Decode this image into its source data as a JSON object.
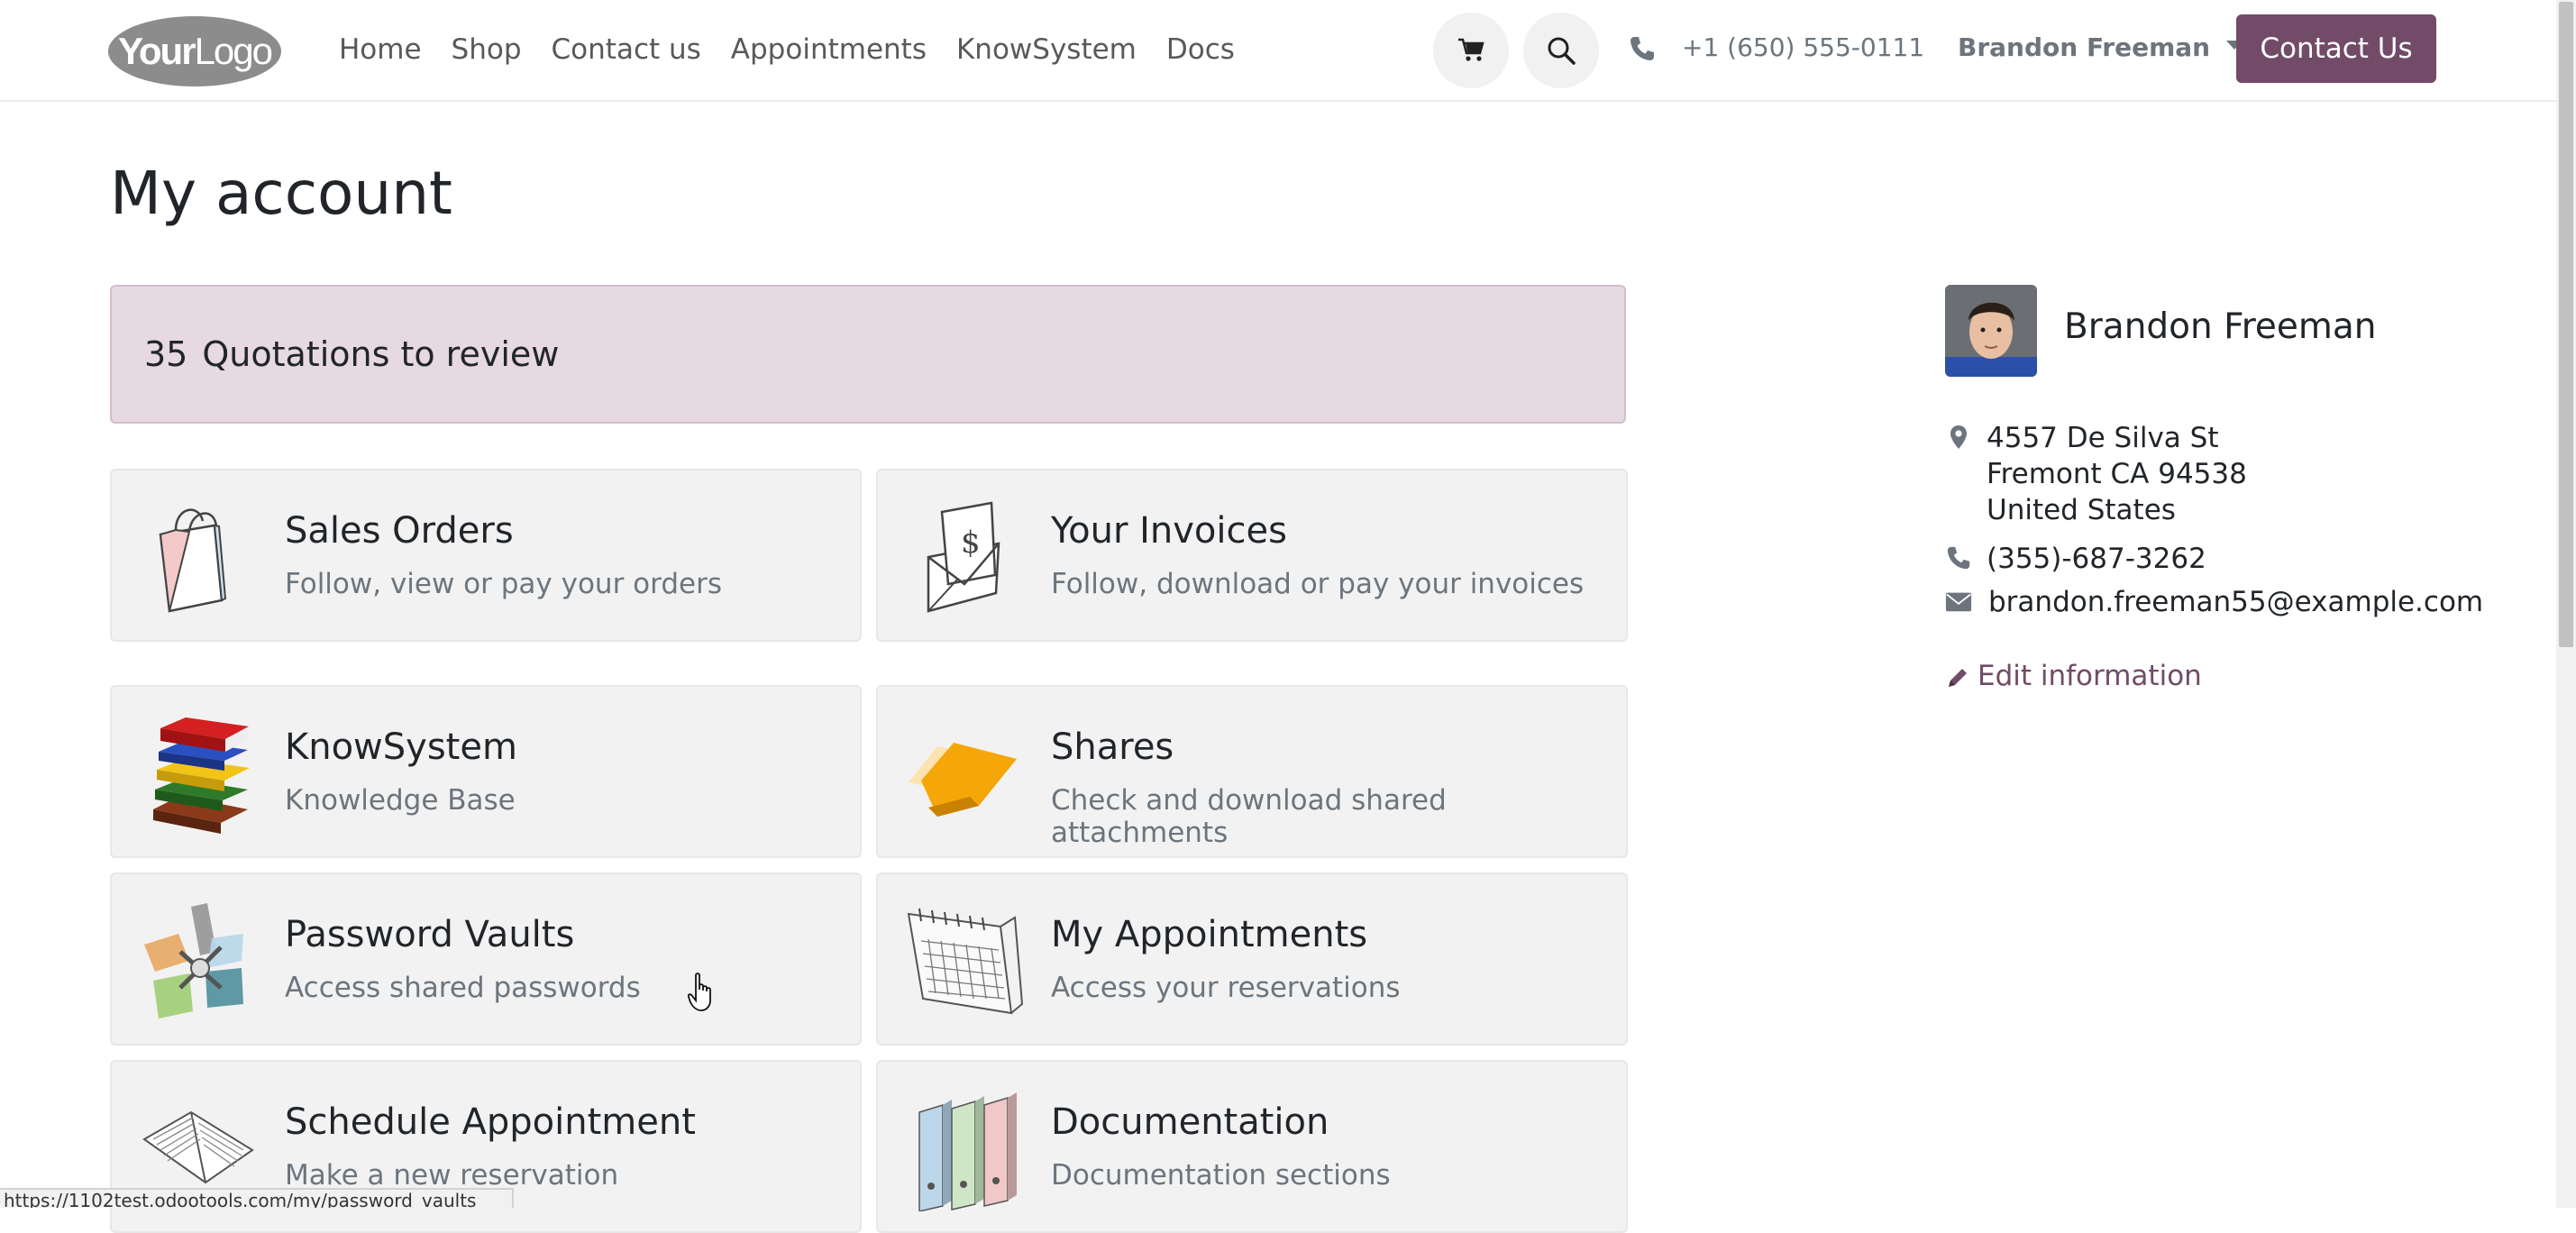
{
  "header": {
    "logo": {
      "bold": "Your",
      "light": "Logo"
    },
    "nav": [
      {
        "label": "Home"
      },
      {
        "label": "Shop"
      },
      {
        "label": "Contact us"
      },
      {
        "label": "Appointments"
      },
      {
        "label": "KnowSystem"
      },
      {
        "label": "Docs"
      }
    ],
    "phone": "+1 (650) 555-0111",
    "user": "Brandon Freeman",
    "contact_button": "Contact Us"
  },
  "main": {
    "title": "My account",
    "alert": {
      "count": "35",
      "label": "Quotations to review"
    },
    "cards": [
      {
        "title": "Sales Orders",
        "description": "Follow, view or pay your orders",
        "icon": "shopping-bag-icon"
      },
      {
        "title": "Your Invoices",
        "description": "Follow, download or pay your invoices",
        "icon": "invoice-envelope-icon"
      },
      {
        "title": "KnowSystem",
        "description": "Knowledge Base",
        "icon": "books-icon"
      },
      {
        "title": "Shares",
        "description": "Check and download shared attachments",
        "icon": "shared-folder-icon"
      },
      {
        "title": "Password Vaults",
        "description": "Access shared passwords",
        "icon": "password-vault-icon"
      },
      {
        "title": "My Appointments",
        "description": "Access your reservations",
        "icon": "calendar-icon"
      },
      {
        "title": "Schedule Appointment",
        "description": "Make a new reservation",
        "icon": "open-book-icon"
      },
      {
        "title": "Documentation",
        "description": "Documentation sections",
        "icon": "binders-icon"
      }
    ]
  },
  "sidebar": {
    "name": "Brandon Freeman",
    "address": [
      "4557 De Silva St",
      "Fremont CA 94538",
      "United States"
    ],
    "phone": "(355)-687-3262",
    "email": "brandon.freeman55@example.com",
    "edit_label": "Edit information"
  },
  "status_bar": {
    "url": "https://1102test.odootools.com/my/password_vaults"
  },
  "colors": {
    "brand": "#714b67",
    "alert_bg": "#e6d9e2",
    "card_bg": "#f2f2f2"
  }
}
